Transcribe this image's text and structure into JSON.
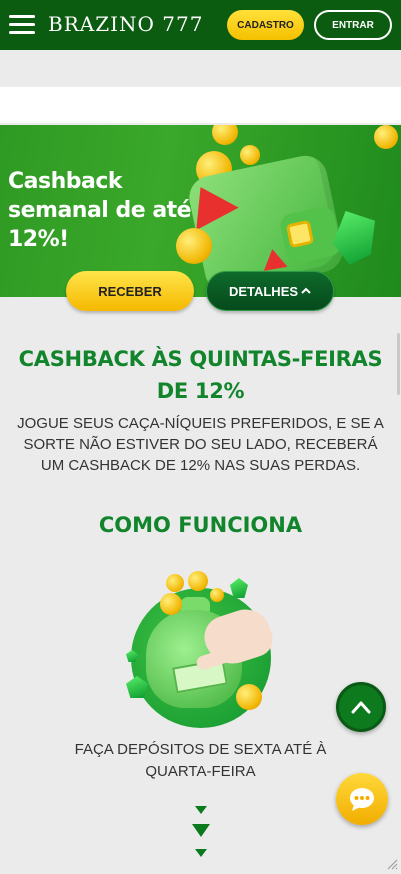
{
  "header": {
    "logo_text": "BRAZINO 777",
    "cadastro_label": "CADASTRO",
    "entrar_label": "ENTRAR"
  },
  "banner": {
    "title_line1": "Cashback",
    "title_line2": "semanal de até",
    "title_line3": "12%!",
    "receber_label": "RECEBER",
    "detalhes_label": "DETALHES"
  },
  "section": {
    "title": "CASHBACK ÀS QUINTAS-FEIRAS DE 12%",
    "description": "JOGUE SEUS CAÇA-NÍQUEIS PREFERIDOS, E SE A SORTE NÃO ESTIVER DO SEU LADO, RECEBERÁ UM CASHBACK DE 12% NAS SUAS PERDAS."
  },
  "como_funciona": {
    "title": "COMO FUNCIONA",
    "step1_text": "FAÇA DEPÓSITOS DE SEXTA ATÉ À QUARTA-FEIRA"
  },
  "colors": {
    "header_bg": "#0b5b10",
    "accent_green": "#12852c",
    "yellow": "#f5c000"
  },
  "icons": [
    "hamburger-menu-icon",
    "chevron-up-icon",
    "chat-icon",
    "arrow-down-icon"
  ]
}
